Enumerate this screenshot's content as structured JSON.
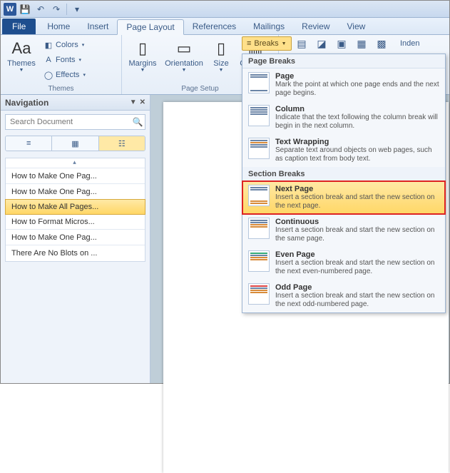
{
  "qat": {
    "save": "save-icon",
    "undo": "undo-icon",
    "redo": "redo-icon"
  },
  "tabs": {
    "file": "File",
    "items": [
      "Home",
      "Insert",
      "Page Layout",
      "References",
      "Mailings",
      "Review",
      "View"
    ],
    "active_index": 2
  },
  "ribbon": {
    "themes": {
      "label": "Themes",
      "button": "Themes",
      "colors": "Colors",
      "fonts": "Fonts",
      "effects": "Effects"
    },
    "page_setup": {
      "label": "Page Setup",
      "margins": "Margins",
      "orientation": "Orientation",
      "size": "Size",
      "columns": "Columns"
    },
    "breaks_btn": "Breaks",
    "indent_fragment": "Inden"
  },
  "navigation": {
    "title": "Navigation",
    "search_placeholder": "Search Document",
    "view_icons": [
      "≡",
      "▦",
      "☷"
    ],
    "items": [
      "How to Make One Pag...",
      "How to Make One Pag...",
      "How to Make All Pages...",
      "How to Format Micros...",
      "How to Make One Pag...",
      "There Are No Blots on ..."
    ],
    "selected_index": 2
  },
  "breaks_menu": {
    "page_breaks_label": "Page Breaks",
    "section_breaks_label": "Section Breaks",
    "page_items": [
      {
        "title": "Page",
        "desc": "Mark the point at which one page ends and the next page begins."
      },
      {
        "title": "Column",
        "desc": "Indicate that the text following the column break will begin in the next column."
      },
      {
        "title": "Text Wrapping",
        "desc": "Separate text around objects on web pages, such as caption text from body text."
      }
    ],
    "section_items": [
      {
        "title": "Next Page",
        "desc": "Insert a section break and start the new section on the next page."
      },
      {
        "title": "Continuous",
        "desc": "Insert a section break and start the new section on the same page."
      },
      {
        "title": "Even Page",
        "desc": "Insert a section break and start the new section on the next even-numbered page."
      },
      {
        "title": "Odd Page",
        "desc": "Insert a section break and start the new section on the next odd-numbered page."
      }
    ],
    "highlighted_section_index": 0
  }
}
